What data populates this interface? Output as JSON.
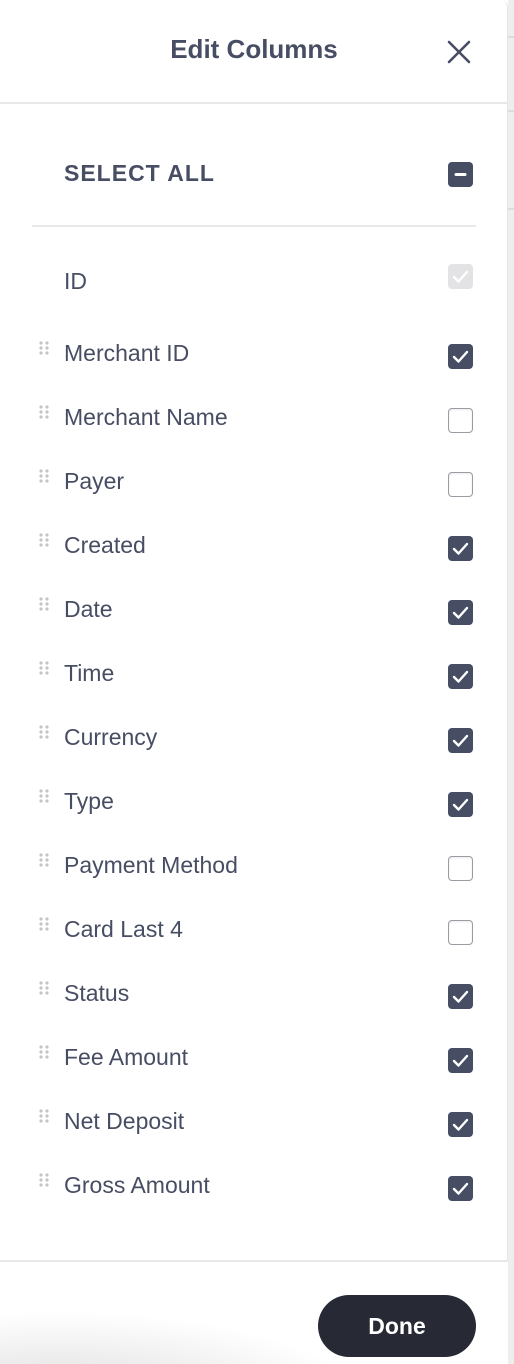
{
  "dialog": {
    "title": "Edit Columns",
    "close_icon": "close-icon"
  },
  "select_all": {
    "label": "SELECT ALL",
    "state": "indeterminate"
  },
  "columns": [
    {
      "label": "ID",
      "checked": true,
      "disabled": true,
      "draggable": false
    },
    {
      "label": "Merchant ID",
      "checked": true,
      "disabled": false,
      "draggable": true
    },
    {
      "label": "Merchant Name",
      "checked": false,
      "disabled": false,
      "draggable": true
    },
    {
      "label": "Payer",
      "checked": false,
      "disabled": false,
      "draggable": true
    },
    {
      "label": "Created",
      "checked": true,
      "disabled": false,
      "draggable": true
    },
    {
      "label": "Date",
      "checked": true,
      "disabled": false,
      "draggable": true
    },
    {
      "label": "Time",
      "checked": true,
      "disabled": false,
      "draggable": true
    },
    {
      "label": "Currency",
      "checked": true,
      "disabled": false,
      "draggable": true
    },
    {
      "label": "Type",
      "checked": true,
      "disabled": false,
      "draggable": true
    },
    {
      "label": "Payment Method",
      "checked": false,
      "disabled": false,
      "draggable": true
    },
    {
      "label": "Card Last 4",
      "checked": false,
      "disabled": false,
      "draggable": true
    },
    {
      "label": "Status",
      "checked": true,
      "disabled": false,
      "draggable": true
    },
    {
      "label": "Fee Amount",
      "checked": true,
      "disabled": false,
      "draggable": true
    },
    {
      "label": "Net Deposit",
      "checked": true,
      "disabled": false,
      "draggable": true
    },
    {
      "label": "Gross Amount",
      "checked": true,
      "disabled": false,
      "draggable": true
    }
  ],
  "footer": {
    "done_label": "Done"
  },
  "colors": {
    "text": "#474d63",
    "checkbox_checked": "#474d63",
    "checkbox_disabled": "#e3e3e5",
    "done_button": "#272a35"
  }
}
